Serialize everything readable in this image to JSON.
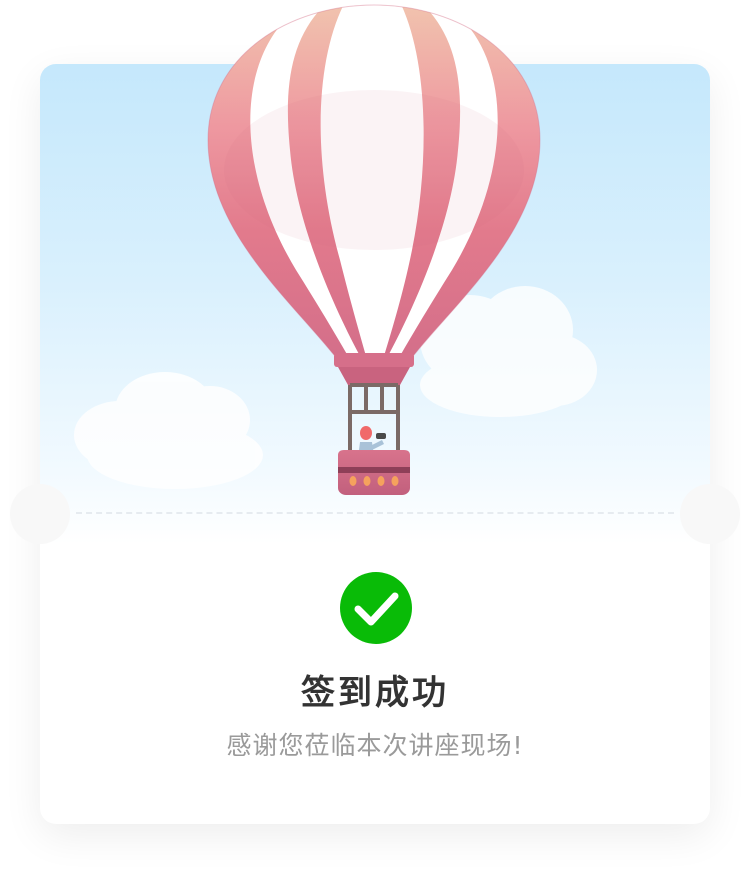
{
  "result": {
    "title": "签到成功",
    "message": "感谢您莅临本次讲座现场!"
  },
  "icons": {
    "status": "check-circle-icon",
    "illustration": "hot-air-balloon-icon"
  },
  "colors": {
    "success": "#09bb07",
    "balloon_stripe": "#e8808f",
    "sky": "#c5e8fc",
    "title_text": "#333333",
    "message_text": "#9a9a9a"
  }
}
